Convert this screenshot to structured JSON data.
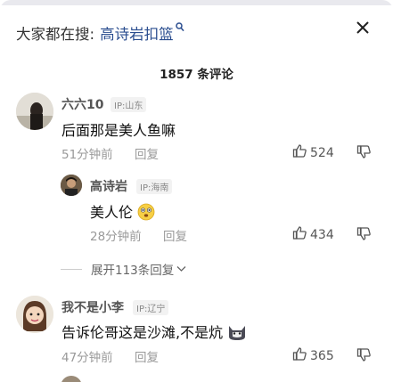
{
  "header": {
    "search_prefix": "大家都在搜:",
    "search_term": "高诗岩扣篮",
    "search_icon": "search-icon",
    "close_icon": "close-icon"
  },
  "comment_count": "1857 条评论",
  "comments": [
    {
      "user": "六六10",
      "ip": "IP:山东",
      "text": "后面那是美人鱼嘛",
      "time": "51分钟前",
      "reply_label": "回复",
      "likes": "524"
    },
    {
      "user": "高诗岩",
      "ip": "IP:海南",
      "text": "美人伦",
      "time": "28分钟前",
      "reply_label": "回复",
      "likes": "434"
    },
    {
      "user": "我不是小李",
      "ip": "IP:辽宁",
      "text": "告诉伦哥这是沙滩,不是炕",
      "time": "47分钟前",
      "reply_label": "回复",
      "likes": "365"
    }
  ],
  "expand_label": "展开113条回复",
  "colors": {
    "search_term": "#2a4d8f",
    "meta": "#999999"
  }
}
